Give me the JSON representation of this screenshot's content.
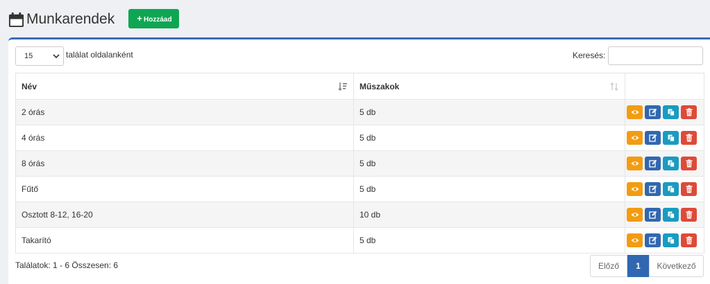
{
  "header": {
    "title": "Munkarendek",
    "title_icon": "calendar-icon",
    "add_button_label": "Hozzáad",
    "add_button_color": "#0fa653"
  },
  "toolbar": {
    "page_length_value": "15",
    "page_length_label": "találat oldalanként",
    "search_label": "Keresés:",
    "search_value": ""
  },
  "table": {
    "columns": [
      "Név",
      "Műszakok",
      ""
    ],
    "rows": [
      {
        "name": "2 órás",
        "shifts": "5 db"
      },
      {
        "name": "4 órás",
        "shifts": "5 db"
      },
      {
        "name": "8 órás",
        "shifts": "5 db"
      },
      {
        "name": "Fűtő",
        "shifts": "5 db"
      },
      {
        "name": "Osztott 8-12, 16-20",
        "shifts": "10 db"
      },
      {
        "name": "Takarító",
        "shifts": "5 db"
      }
    ],
    "row_actions": [
      "eye-icon",
      "edit-icon",
      "copy-icon",
      "trash-icon"
    ]
  },
  "footer": {
    "info": "Találatok: 1 - 6 Összesen: 6",
    "pagination": {
      "prev": "Előző",
      "current": "1",
      "next": "Következő"
    }
  },
  "colors": {
    "accent": "#3167b1",
    "view": "#f39c12",
    "edit": "#3167b1",
    "copy": "#1a9bc0",
    "delete": "#dd4b39"
  }
}
